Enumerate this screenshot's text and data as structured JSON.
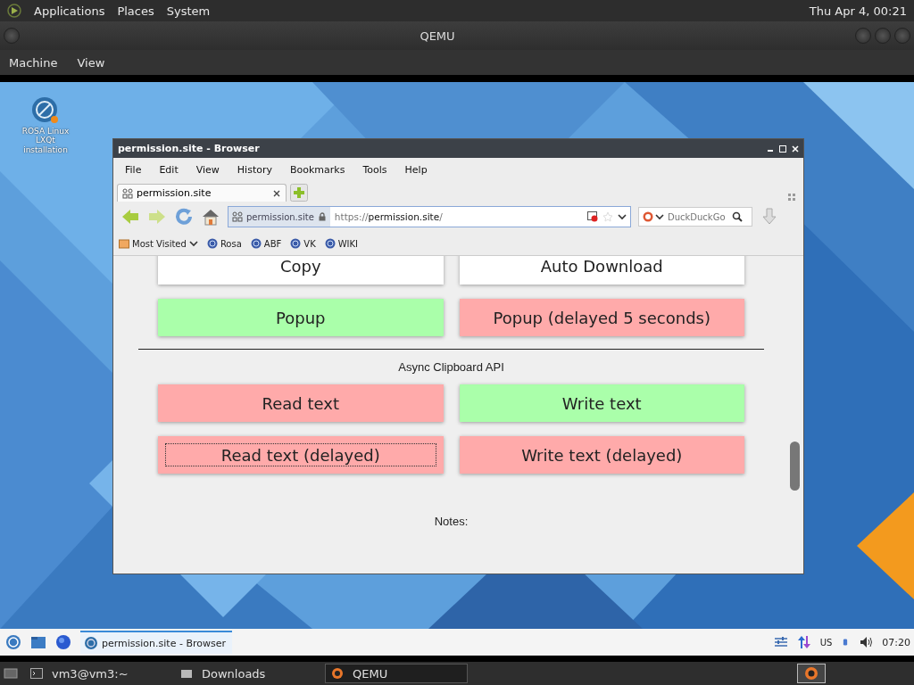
{
  "top_panel": {
    "menus": [
      "Applications",
      "Places",
      "System"
    ],
    "clock": "Thu Apr  4, 00:21"
  },
  "qemu_window": {
    "title": "QEMU",
    "menu": [
      "Machine",
      "View"
    ]
  },
  "desktop_icons": [
    {
      "label": "ROSA Linux LXQt installation"
    }
  ],
  "browser": {
    "title": "permission.site - Browser",
    "menu": [
      "File",
      "Edit",
      "View",
      "History",
      "Bookmarks",
      "Tools",
      "Help"
    ],
    "tabs": [
      {
        "label": "permission.site",
        "selected": true
      }
    ],
    "url_bar": {
      "site": "permission.site",
      "scheme": "https://",
      "host": "permission.site",
      "path": "/"
    },
    "search": {
      "placeholder": "DuckDuckGo"
    },
    "bookmarks": [
      "Most Visited",
      "Rosa",
      "ABF",
      "VK",
      "WIKI"
    ],
    "content": {
      "button_rows": [
        [
          {
            "label": "Copy",
            "color": "#ffffff",
            "focused": false
          },
          {
            "label": "Auto Download",
            "color": "#ffffff",
            "focused": false
          }
        ],
        [
          {
            "label": "Popup",
            "color": "#aaffaa",
            "focused": false
          },
          {
            "label": "Popup (delayed 5 seconds)",
            "color": "#ffaaaa",
            "focused": false
          }
        ]
      ],
      "section_title": "Async Clipboard API",
      "section_rows": [
        [
          {
            "label": "Read text",
            "color": "#ffaaaa",
            "focused": false
          },
          {
            "label": "Write text",
            "color": "#aaffaa",
            "focused": false
          }
        ],
        [
          {
            "label": "Read text (delayed)",
            "color": "#ffaaaa",
            "focused": true
          },
          {
            "label": "Write text (delayed)",
            "color": "#ffaaaa",
            "focused": false
          }
        ]
      ],
      "notes": "Notes:"
    }
  },
  "guest_taskbar": {
    "tasks": [
      {
        "label": "permission.site - Browser",
        "selected": true
      }
    ],
    "keyboard": "US",
    "clock": "07:20"
  },
  "host_taskbar": {
    "tasks": [
      {
        "label": "vm3@vm3:~",
        "selected": false
      },
      {
        "label": "Downloads",
        "selected": false
      },
      {
        "label": "QEMU",
        "selected": true
      }
    ]
  }
}
